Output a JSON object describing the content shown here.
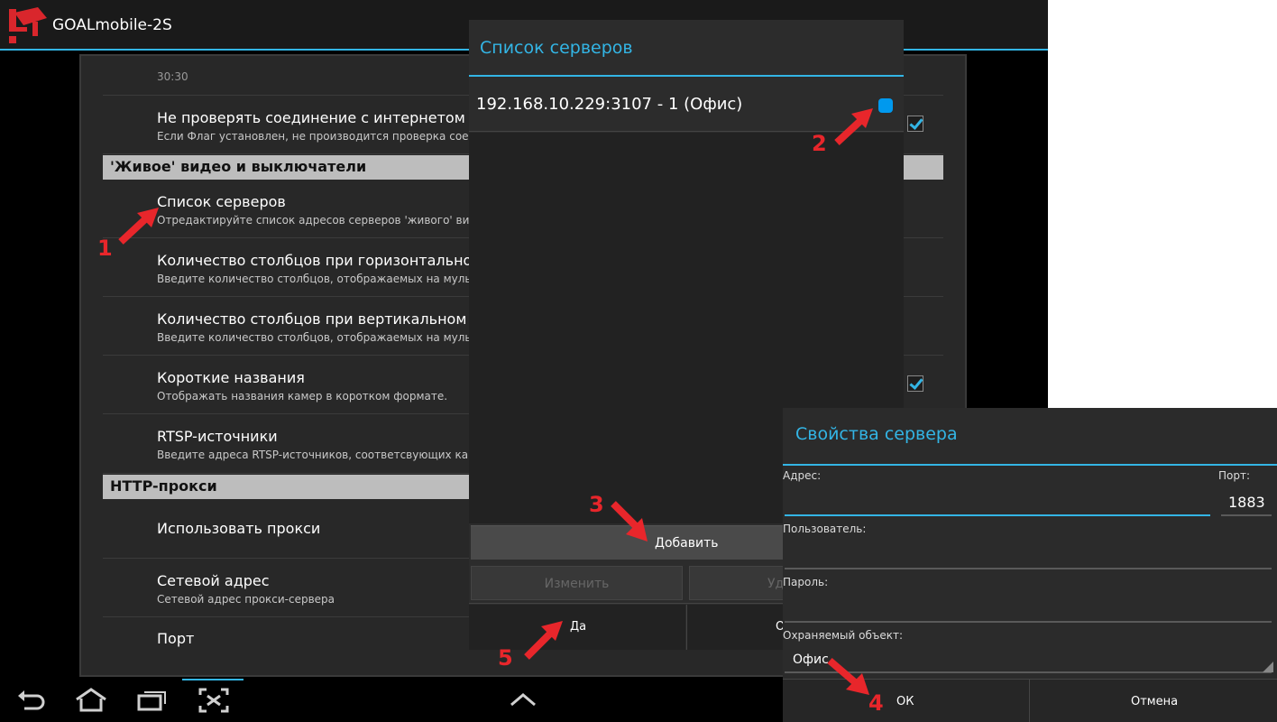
{
  "app": {
    "title": "GOALmobile-2S"
  },
  "settings": {
    "truncated_value": "30:30",
    "items": [
      {
        "title": "Не проверять соединение с интернетом",
        "summary": "Если Флаг установлен, не производится проверка соедин"
      },
      {
        "title": "Список серверов",
        "summary": "Отредактируйте список адресов серверов 'живого' видео"
      },
      {
        "title": "Количество столбцов при горизонтальном ра",
        "summary": "Введите количество столбцов, отображаемых на мультиз"
      },
      {
        "title": "Количество столбцов при вертикальном расп",
        "summary": "Введите количество столбцов, отображаемых на мультиз"
      },
      {
        "title": "Короткие названия",
        "summary": "Отображать названия камер в коротком формате."
      },
      {
        "title": "RTSP-источники",
        "summary": "Введите адреса RTSP-источников, соответсвующих каме"
      },
      {
        "title": "Использовать прокси",
        "summary": ""
      },
      {
        "title": "Сетевой адрес",
        "summary": "Сетевой адрес прокси-сервера"
      },
      {
        "title": "Порт",
        "summary": ""
      }
    ],
    "categories": [
      "'Живое' видео и выключатели",
      "HTTP-прокси"
    ]
  },
  "server_list_dialog": {
    "title": "Список серверов",
    "servers": [
      "192.168.10.229:3107 - 1  (Офис)"
    ],
    "add_label": "Добавить",
    "edit_label": "Изменить",
    "delete_label": "Уд",
    "yes_label": "Да",
    "cancel_label": "О"
  },
  "server_props_dialog": {
    "title": "Свойства сервера",
    "address_label": "Адрес:",
    "address_value": "",
    "port_label": "Порт:",
    "port_value": "1883",
    "user_label": "Пользователь:",
    "password_label": "Пароль:",
    "object_label": "Охраняемый объект:",
    "object_value": "Офис",
    "ok_label": "ОК",
    "cancel_label": "Отмена"
  },
  "annotations": [
    "1",
    "2",
    "3",
    "4",
    "5"
  ],
  "colors": {
    "accent": "#33b5e5",
    "annotation": "#e8262b",
    "category_bg": "#bdbdbd"
  },
  "icons": [
    "camera-logo-icon",
    "back-icon",
    "home-icon",
    "recent-apps-icon",
    "screenshot-icon",
    "chevron-up-icon"
  ]
}
